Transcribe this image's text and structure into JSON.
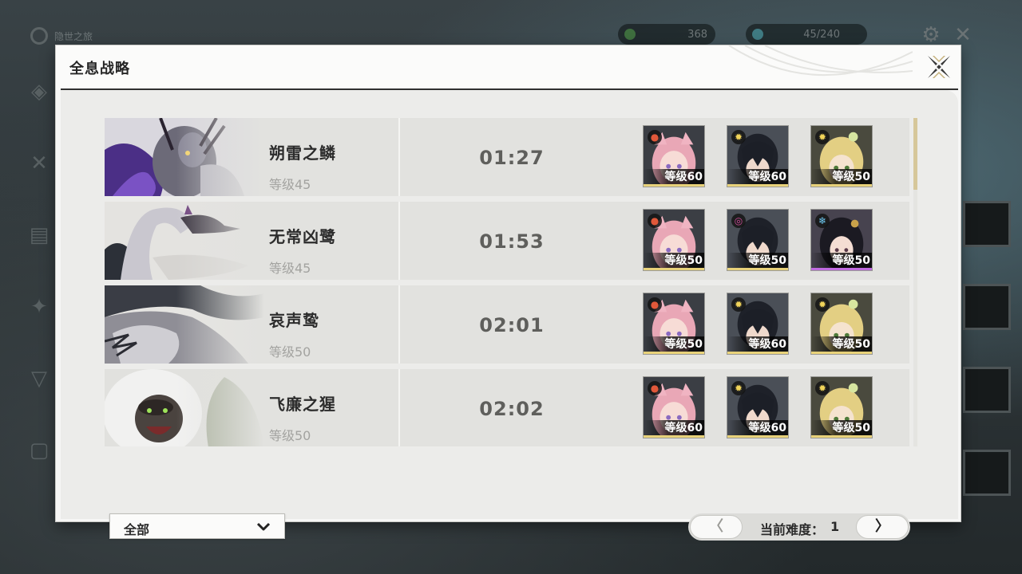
{
  "background": {
    "title": "隐世之旅",
    "pill1": "368",
    "pill2": "45/240"
  },
  "modal": {
    "title": "全息战略"
  },
  "rows": [
    {
      "name": "朔雷之鳞",
      "level": "等级45",
      "time": "01:27",
      "team": [
        {
          "level": "等级60",
          "element": "fusion",
          "accent": "#e8d27a"
        },
        {
          "level": "等级60",
          "element": "spectro",
          "accent": "#e8d27a"
        },
        {
          "level": "等级50",
          "element": "spectro",
          "accent": "#e8d27a"
        }
      ]
    },
    {
      "name": "无常凶鹭",
      "level": "等级45",
      "time": "01:53",
      "team": [
        {
          "level": "等级50",
          "element": "fusion",
          "accent": "#e8d27a"
        },
        {
          "level": "等级50",
          "element": "havoc",
          "accent": "#e8d27a"
        },
        {
          "level": "等级50",
          "element": "glacio",
          "accent": "#c06be0"
        }
      ]
    },
    {
      "name": "哀声鸷",
      "level": "等级50",
      "time": "02:01",
      "team": [
        {
          "level": "等级50",
          "element": "fusion",
          "accent": "#e8d27a"
        },
        {
          "level": "等级60",
          "element": "spectro",
          "accent": "#e8d27a"
        },
        {
          "level": "等级50",
          "element": "spectro",
          "accent": "#e8d27a"
        }
      ]
    },
    {
      "name": "飞廉之猩",
      "level": "等级50",
      "time": "02:02",
      "team": [
        {
          "level": "等级60",
          "element": "fusion",
          "accent": "#e8d27a"
        },
        {
          "level": "等级60",
          "element": "spectro",
          "accent": "#e8d27a"
        },
        {
          "level": "等级50",
          "element": "spectro",
          "accent": "#e8d27a"
        }
      ]
    }
  ],
  "filter": {
    "label": "全部"
  },
  "pager": {
    "label": "当前难度：",
    "value": "1",
    "prev": "〈",
    "next": "〉"
  },
  "colors": {
    "accent_gold": "#d6c79a",
    "header_rule": "#2f2f2f"
  },
  "icons": [
    "close-icon",
    "chevron-down-icon",
    "fusion-element-icon",
    "spectro-element-icon",
    "havoc-element-icon",
    "glacio-element-icon"
  ]
}
